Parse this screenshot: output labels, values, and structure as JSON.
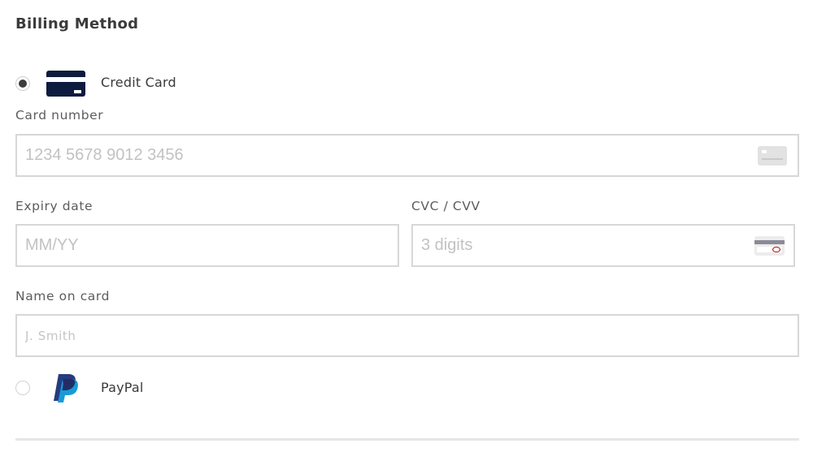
{
  "billing": {
    "title": "Billing Method",
    "methods": [
      {
        "label": "Credit Card",
        "selected": true,
        "icon": "credit-card-icon"
      },
      {
        "label": "PayPal",
        "selected": false,
        "icon": "paypal-logo-icon"
      }
    ],
    "card_number": {
      "label": "Card number",
      "placeholder": "1234 5678 9012 3456",
      "value": "",
      "icon": "card-front-icon"
    },
    "expiry": {
      "label": "Expiry date",
      "placeholder": "MM/YY",
      "value": ""
    },
    "cvc": {
      "label": "CVC / CVV",
      "placeholder": "3 digits",
      "value": "",
      "icon": "card-back-cvc-icon"
    },
    "name": {
      "label": "Name on card",
      "placeholder": "J. Smith",
      "value": ""
    }
  },
  "colors": {
    "card_icon_navy": "#0d1b3e",
    "paypal_dark_blue": "#253b80",
    "paypal_light_blue": "#179bd7",
    "border": "#d7d7d7",
    "placeholder": "#c2c2c2"
  }
}
